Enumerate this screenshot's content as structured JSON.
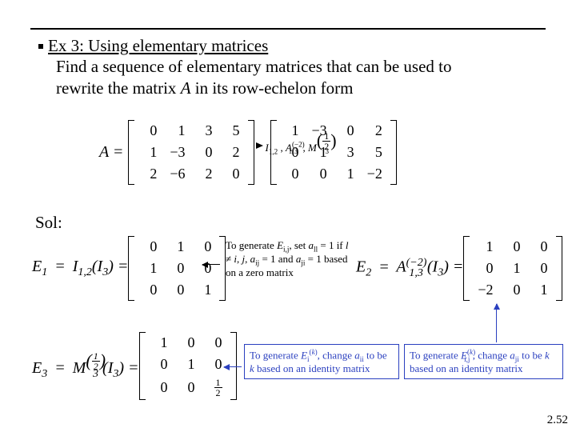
{
  "heading": {
    "title": "Ex 3: Using elementary matrices",
    "line2a": "Find a sequence of elementary matrices that can be used to",
    "line2b": "rewrite the matrix ",
    "line2b_var": "A",
    "line2b_tail": " in its row-echelon form"
  },
  "sol_label": "Sol:",
  "slidenum": "2.52",
  "chart_data": {
    "type": "table",
    "example": {
      "A_label": "A =",
      "A": [
        [
          0,
          1,
          3,
          5
        ],
        [
          1,
          -3,
          0,
          2
        ],
        [
          2,
          -6,
          2,
          0
        ]
      ],
      "arrow_ops": [
        "I_{1,2}",
        "A_{1,3}^{(-2)}",
        "M_3^{(1/2)}"
      ],
      "A_echelon": [
        [
          1,
          -3,
          0,
          2
        ],
        [
          0,
          1,
          3,
          5
        ],
        [
          0,
          0,
          1,
          -2
        ]
      ]
    },
    "E1": {
      "label": "E₁ = I_{1,2}(I₃) =",
      "label_lhs": "E",
      "label_sub": "1",
      "op": "I",
      "op_sub": "1,2",
      "arg": "(I",
      "arg_sub": "3",
      "arg_tail": ") =",
      "matrix": [
        [
          0,
          1,
          0
        ],
        [
          1,
          0,
          0
        ],
        [
          0,
          0,
          1
        ]
      ]
    },
    "E2": {
      "label_lhs": "E",
      "label_sub": "2",
      "op": "A",
      "op_sub": "1,3",
      "op_sup": "(−2)",
      "arg": "(I",
      "arg_sub": "3",
      "arg_tail": ") =",
      "matrix": [
        [
          1,
          0,
          0
        ],
        [
          0,
          1,
          0
        ],
        [
          -2,
          0,
          1
        ]
      ]
    },
    "E3": {
      "label_lhs": "E",
      "label_sub": "3",
      "op": "M",
      "op_sub": "3",
      "op_sup_frac": {
        "num": "1",
        "den": "2"
      },
      "arg": "(I",
      "arg_sub": "3",
      "arg_tail": ") =",
      "matrix_display": [
        [
          "1",
          "0",
          "0"
        ],
        [
          "0",
          "1",
          "0"
        ],
        [
          "0",
          "0",
          "½"
        ]
      ],
      "matrix": [
        [
          1,
          0,
          0
        ],
        [
          0,
          1,
          0
        ],
        [
          0,
          0,
          0.5
        ]
      ]
    },
    "notes": {
      "n1": "To generate E_{i,j}, set a_{ll} = 1 if l ≠ i, j, a_{ij} = 1 and a_{ji} = 1 based on a zero matrix",
      "n2": "To generate E_i^{(k)}, change a_{ii} to be k based on an identity matrix",
      "n3": "To generate E_{i,j}^{(k)}, change a_{ji} to be k based on an identity matrix"
    }
  }
}
